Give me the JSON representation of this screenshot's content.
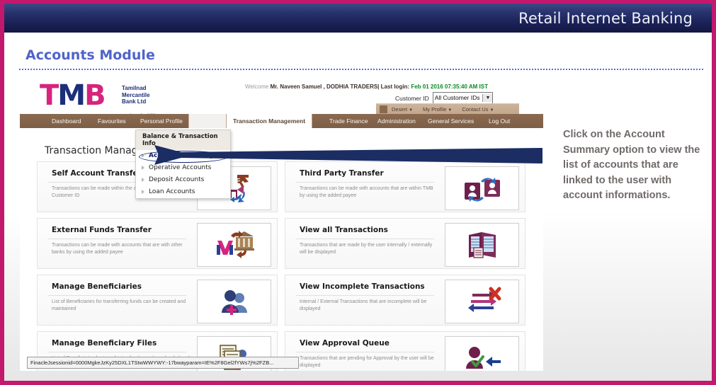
{
  "slide": {
    "banner_title": "Retail Internet Banking",
    "module_title": "Accounts Module"
  },
  "callout": {
    "text": "Click on the Account Summary option to view the list of accounts that are linked to the user with account informations."
  },
  "app": {
    "logo": {
      "letter_t": "T",
      "letter_m": "M",
      "letter_b": "B",
      "subtitle": "Tamilnad\nMercantile\nBank Ltd",
      "tagline": "Be a step ahead of life"
    },
    "welcome": {
      "label": "Welcome",
      "user": "Mr.  Naveen  Samuel , DODHIA TRADERS|",
      "last_login_label": "Last login:",
      "last_login_value": "Feb 01 2016 07:35:40 AM IST"
    },
    "customer": {
      "label": "Customer ID",
      "selected": "All Customer IDs",
      "caret": "▼"
    },
    "utility_menu": [
      {
        "label": "Desert",
        "caret": "▼"
      },
      {
        "label": "My Profile",
        "caret": "▼"
      },
      {
        "label": "Contact Us",
        "caret": "▼"
      }
    ],
    "nav": [
      {
        "label": "Dashboard",
        "active": false
      },
      {
        "label": "Favourites",
        "active": false
      },
      {
        "label": "Personal Profile",
        "active": false
      },
      {
        "label": "Transaction Management",
        "active": true
      },
      {
        "label": "Trade Finance",
        "active": false
      },
      {
        "label": "Administration",
        "active": false
      },
      {
        "label": "General Services",
        "active": false
      },
      {
        "label": "Log Out",
        "active": false
      }
    ],
    "dropdown": {
      "header": "Balance & Transaction Info",
      "items": [
        {
          "label": "Account Summary",
          "highlighted": true
        },
        {
          "label": "Operative Accounts",
          "highlighted": false
        },
        {
          "label": "Deposit Accounts",
          "highlighted": false
        },
        {
          "label": "Loan Accounts",
          "highlighted": false
        }
      ]
    },
    "page_heading": "Transaction Management",
    "tiles": [
      {
        "title": "Self Account Transfer",
        "desc": "Transactions can be made within the accounts linked to the Customer ID",
        "icon": "rupee-transfer-icon"
      },
      {
        "title": "Third Party Transfer",
        "desc": "Transactions can be made with accounts that are within TMB by using the added payee",
        "icon": "two-people-transfer-icon"
      },
      {
        "title": "External Funds Transfer",
        "desc": "Transactions can be made with accounts that are with other banks by using the added payee",
        "icon": "bank-transfer-icon"
      },
      {
        "title": "View all Transactions",
        "desc": "Transactions that are made by the user internally / externally will be displayed",
        "icon": "ledger-book-icon"
      },
      {
        "title": "Manage Beneficiaries",
        "desc": "List of Beneficiaries for transferring funds can be created and maintained",
        "icon": "add-people-icon"
      },
      {
        "title": "View Incomplete Transactions",
        "desc": "Internal / External Transactions that are incomplete will be displayed",
        "icon": "arrows-cross-icon"
      },
      {
        "title": "Manage Beneficiary Files",
        "desc": "List of Beneficiaries for transferring funds can be uploaded and maintained by using files",
        "icon": "document-people-icon"
      },
      {
        "title": "View Approval Queue",
        "desc": "Transactions that are pending for Approval by the user will be displayed",
        "icon": "person-approve-icon"
      }
    ],
    "status_bar": {
      "text": "FinacleJsessionid=0000MgkeJzKy25DXL1TStwWWYWY:-17bwayparam=IE%2F8Gel2fYWs7j%2FZB..."
    }
  },
  "colors": {
    "frame": "#c2186e",
    "banner": "#26306b",
    "module_title": "#4f63c9",
    "nav_bar": "#7d5f47",
    "logo_pink": "#d6247e",
    "logo_blue": "#1c2f7a",
    "arrow": "#1b2d63",
    "last_login": "#0a8a28",
    "callout_text": "#6f6a68"
  }
}
